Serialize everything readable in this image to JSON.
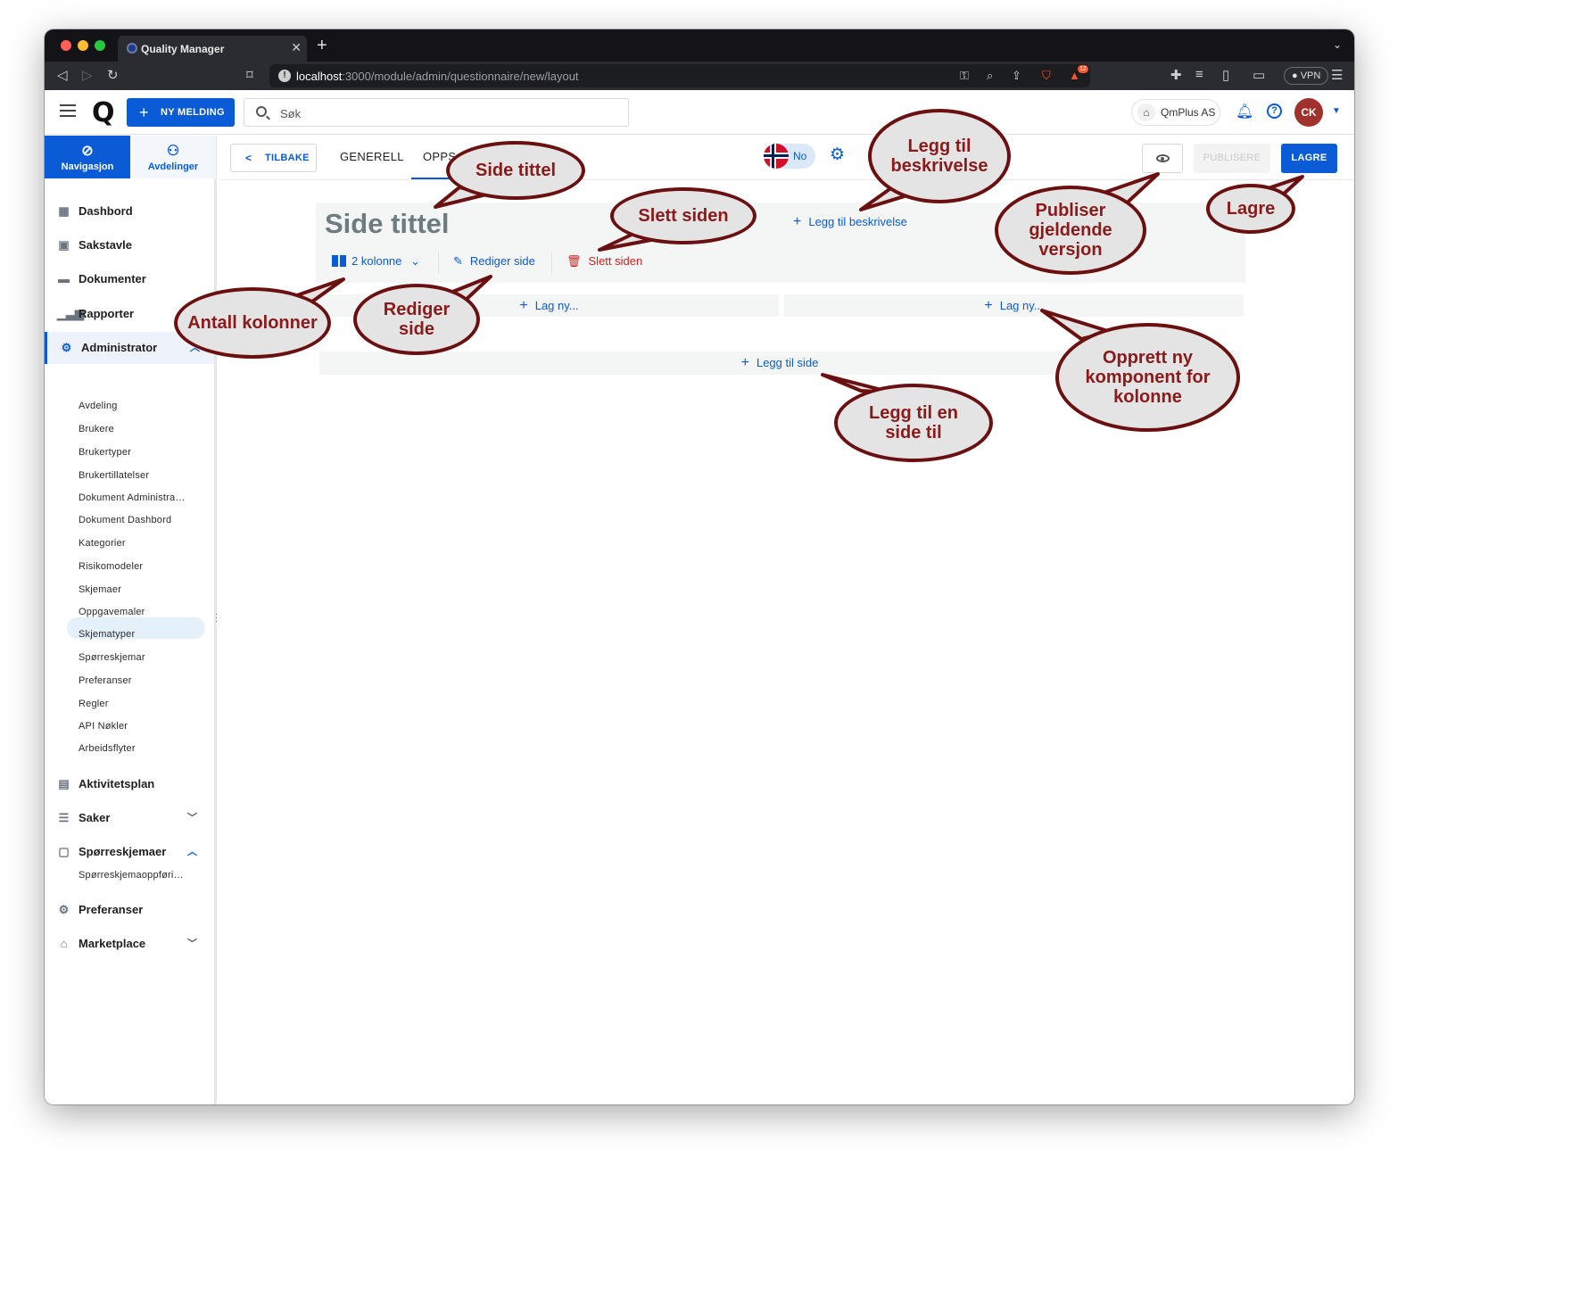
{
  "browser": {
    "tab_title": "Quality Manager",
    "url_host": "localhost",
    "url_path": ":3000/module/admin/questionnaire/new/layout",
    "brave_count": "12",
    "vpn_label": "VPN"
  },
  "header": {
    "new_message_label": "NY MELDING",
    "search_placeholder": "Søk",
    "company": "QmPlus AS",
    "user_initials": "CK"
  },
  "sidebar": {
    "tabs": [
      {
        "label": "Navigasjon"
      },
      {
        "label": "Avdelinger"
      }
    ],
    "items": [
      {
        "label": "Dashbord"
      },
      {
        "label": "Sakstavle"
      },
      {
        "label": "Dokumenter"
      },
      {
        "label": "Rapporter"
      },
      {
        "label": "Administrator"
      },
      {
        "label": "Aktivitetsplan"
      },
      {
        "label": "Saker"
      },
      {
        "label": "Spørreskjemaer"
      },
      {
        "label": "Preferanser"
      },
      {
        "label": "Marketplace"
      }
    ],
    "admin_sub": [
      "Avdeling",
      "Brukere",
      "Brukertyper",
      "Brukertillatelser",
      "Dokument Administra…",
      "Dokument Dashbord",
      "Kategorier",
      "Risikomodeler",
      "Skjemaer",
      "Oppgavemaler",
      "Skjematyper",
      "Spørreskjemar",
      "Preferanser",
      "Regler",
      "API Nøkler",
      "Arbeidsflyter"
    ],
    "questionnaire_sub": [
      "Spørreskjemaoppføri…"
    ]
  },
  "toolbar": {
    "back_label": "TILBAKE",
    "tab_general": "GENERELL",
    "tab_layout_partial": "OPPS",
    "language": "No",
    "publish_label": "PUBLISERE",
    "save_label": "LAGRE"
  },
  "page": {
    "title": "Side tittel",
    "add_description": "Legg til beskrivelse",
    "columns_label": "2 kolonne",
    "edit_label": "Rediger side",
    "delete_label": "Slett siden",
    "column_new_label": "Lag ny...",
    "add_page_label": "Legg til side"
  },
  "callouts": [
    {
      "text": "Side tittel"
    },
    {
      "text": "Legg til\nbeskrivelse"
    },
    {
      "text": "Slett siden"
    },
    {
      "text": "Publiser\ngjeldende\nversjon"
    },
    {
      "text": "Lagre"
    },
    {
      "text": "Antall kolonner"
    },
    {
      "text": "Rediger\nside"
    },
    {
      "text": "Opprett ny\nkomponent for\nkolonne"
    },
    {
      "text": "Legg til en\nside til"
    }
  ],
  "colors": {
    "primary": "#0b5bd7",
    "danger": "#d21f1f",
    "callout_text": "#8b1a1a",
    "callout_border": "#6b1010",
    "avatar": "#a0312d"
  }
}
